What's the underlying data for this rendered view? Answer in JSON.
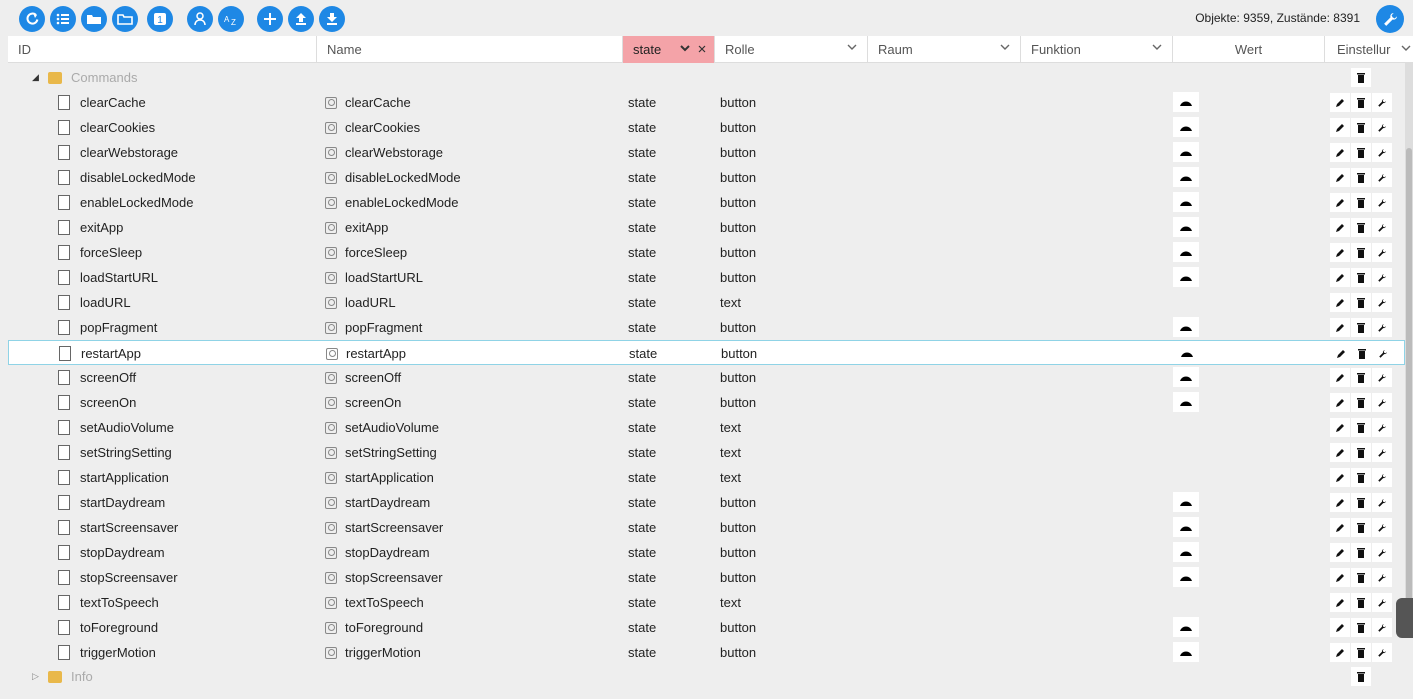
{
  "toolbar": {
    "buttons": [
      "refresh-icon",
      "list-icon",
      "folder-open-icon",
      "folder-icon",
      "one-badge-icon",
      "user-admin-icon",
      "sort-az-icon",
      "add-icon",
      "upload-icon",
      "download-icon"
    ],
    "counts": "Objekte: 9359, Zustände: 8391"
  },
  "columns": {
    "id": "ID",
    "name": "Name",
    "state_filter": "state",
    "role": "Rolle",
    "room": "Raum",
    "function": "Funktion",
    "value": "Wert",
    "settings": "Einstellur"
  },
  "folders": {
    "commands": "Commands",
    "info": "Info"
  },
  "rows": [
    {
      "id": "clearCache",
      "name": "clearCache",
      "type": "state",
      "role": "button"
    },
    {
      "id": "clearCookies",
      "name": "clearCookies",
      "type": "state",
      "role": "button"
    },
    {
      "id": "clearWebstorage",
      "name": "clearWebstorage",
      "type": "state",
      "role": "button"
    },
    {
      "id": "disableLockedMode",
      "name": "disableLockedMode",
      "type": "state",
      "role": "button"
    },
    {
      "id": "enableLockedMode",
      "name": "enableLockedMode",
      "type": "state",
      "role": "button"
    },
    {
      "id": "exitApp",
      "name": "exitApp",
      "type": "state",
      "role": "button"
    },
    {
      "id": "forceSleep",
      "name": "forceSleep",
      "type": "state",
      "role": "button"
    },
    {
      "id": "loadStartURL",
      "name": "loadStartURL",
      "type": "state",
      "role": "button"
    },
    {
      "id": "loadURL",
      "name": "loadURL",
      "type": "state",
      "role": "text"
    },
    {
      "id": "popFragment",
      "name": "popFragment",
      "type": "state",
      "role": "button"
    },
    {
      "id": "restartApp",
      "name": "restartApp",
      "type": "state",
      "role": "button"
    },
    {
      "id": "screenOff",
      "name": "screenOff",
      "type": "state",
      "role": "button"
    },
    {
      "id": "screenOn",
      "name": "screenOn",
      "type": "state",
      "role": "button"
    },
    {
      "id": "setAudioVolume",
      "name": "setAudioVolume",
      "type": "state",
      "role": "text"
    },
    {
      "id": "setStringSetting",
      "name": "setStringSetting",
      "type": "state",
      "role": "text"
    },
    {
      "id": "startApplication",
      "name": "startApplication",
      "type": "state",
      "role": "text"
    },
    {
      "id": "startDaydream",
      "name": "startDaydream",
      "type": "state",
      "role": "button"
    },
    {
      "id": "startScreensaver",
      "name": "startScreensaver",
      "type": "state",
      "role": "button"
    },
    {
      "id": "stopDaydream",
      "name": "stopDaydream",
      "type": "state",
      "role": "button"
    },
    {
      "id": "stopScreensaver",
      "name": "stopScreensaver",
      "type": "state",
      "role": "button"
    },
    {
      "id": "textToSpeech",
      "name": "textToSpeech",
      "type": "state",
      "role": "text"
    },
    {
      "id": "toForeground",
      "name": "toForeground",
      "type": "state",
      "role": "button"
    },
    {
      "id": "triggerMotion",
      "name": "triggerMotion",
      "type": "state",
      "role": "button"
    }
  ],
  "selected_row": "restartApp",
  "colors": {
    "accent": "#1e88e5",
    "filter_active": "#f4a3a8",
    "selection_border": "#8fd3e6",
    "folder": "#e9b84a"
  }
}
